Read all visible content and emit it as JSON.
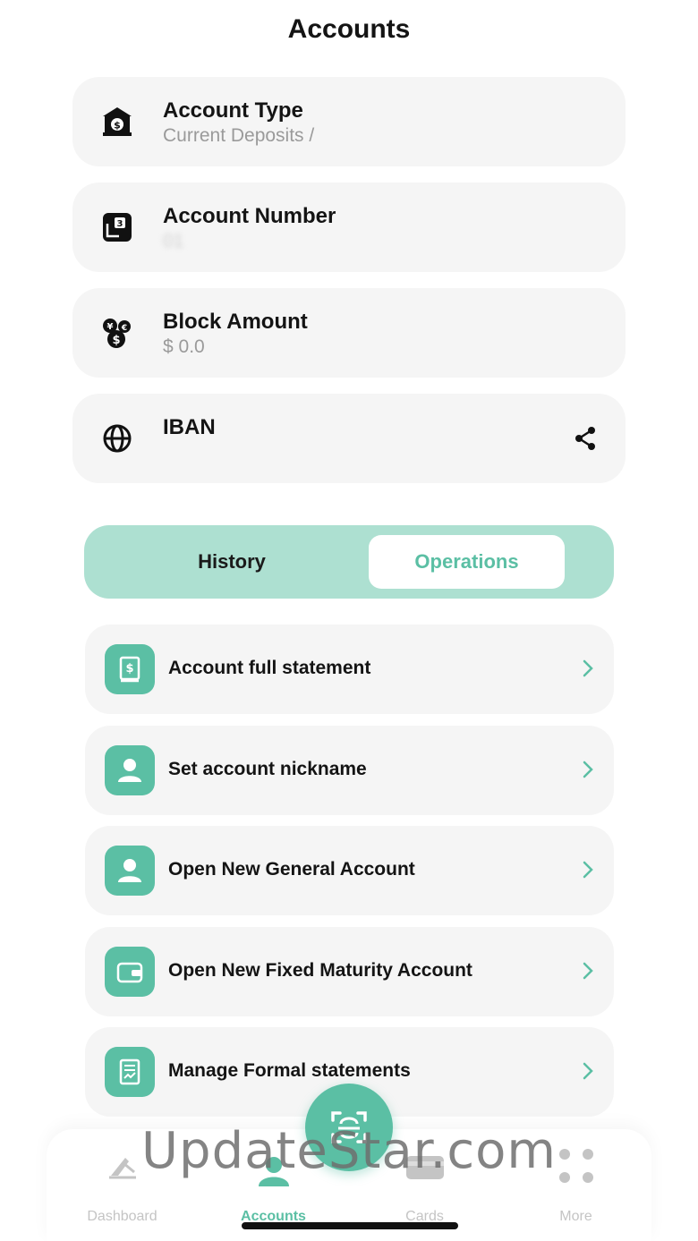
{
  "header": {
    "title": "Accounts"
  },
  "info_cards": [
    {
      "label": "Account Type",
      "value": "Current Deposits /",
      "icon": "bank-icon"
    },
    {
      "label": "Account Number",
      "value": "01",
      "icon": "account-number-icon"
    },
    {
      "label": "Block Amount",
      "value": "$ 0.0",
      "icon": "currency-coins-icon"
    },
    {
      "label": "IBAN",
      "value": "",
      "icon": "globe-icon"
    }
  ],
  "segment": {
    "history_label": "History",
    "operations_label": "Operations",
    "selected": "Operations"
  },
  "operations": [
    {
      "label": "Account full statement",
      "icon": "statement-book-icon"
    },
    {
      "label": "Set account nickname",
      "icon": "person-icon"
    },
    {
      "label": "Open New General Account",
      "icon": "person-icon"
    },
    {
      "label": "Open New Fixed Maturity Account",
      "icon": "wallet-icon"
    },
    {
      "label": "Manage Formal statements",
      "icon": "formal-statement-icon"
    }
  ],
  "tabbar": {
    "items": [
      {
        "label": "Dashboard",
        "icon": "dashboard-icon"
      },
      {
        "label": "Accounts",
        "icon": "person-icon"
      },
      {
        "label": "Cards",
        "icon": "card-icon"
      },
      {
        "label": "More",
        "icon": "dots-grid-icon"
      }
    ],
    "active": "Accounts"
  },
  "watermark": "UpdateStar.com",
  "colors": {
    "accent": "#5bbfa4",
    "segment_bg": "#ade0d1",
    "card_bg": "#f5f5f5",
    "muted_text": "#9a9a9a"
  }
}
